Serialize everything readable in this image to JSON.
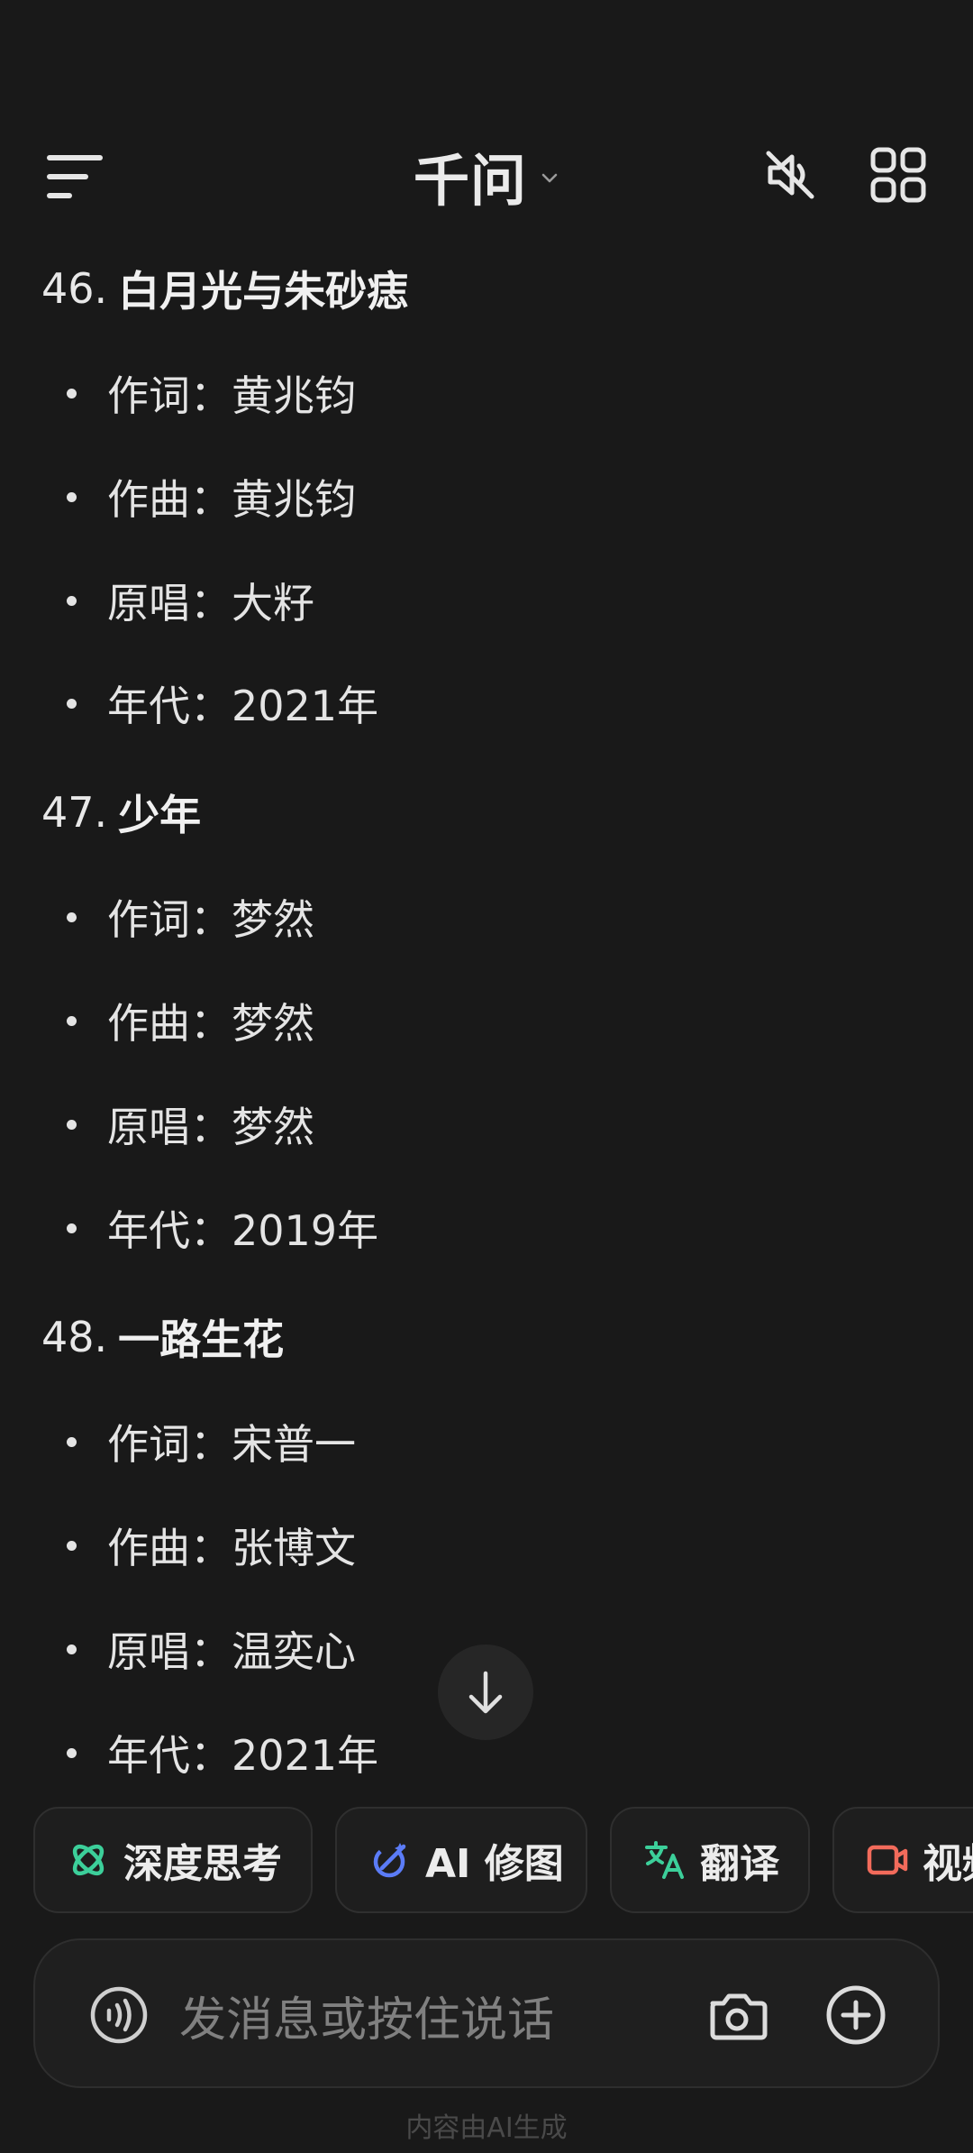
{
  "header": {
    "title": "千问",
    "menu_icon": "menu-lines-icon",
    "mute_icon": "speaker-muted-icon",
    "apps_icon": "grid-apps-icon"
  },
  "songs": [
    {
      "number": "46.",
      "title": "白月光与朱砂痣",
      "lines": [
        "作词：黄兆钧",
        "作曲：黄兆钧",
        "原唱：大籽",
        "年代：2021年"
      ]
    },
    {
      "number": "47.",
      "title": "少年",
      "lines": [
        "作词：梦然",
        "作曲：梦然",
        "原唱：梦然",
        "年代：2019年"
      ]
    },
    {
      "number": "48.",
      "title": "一路生花",
      "lines": [
        "作词：宋普一",
        "作曲：张博文",
        "原唱：温奕心",
        "年代：2021年"
      ]
    }
  ],
  "chips": [
    {
      "label": "深度思考",
      "icon": "deep-think-icon",
      "color": "#3ccf9a"
    },
    {
      "label": "AI 修图",
      "icon": "ai-edit-image-icon",
      "color": "#5b7cf7"
    },
    {
      "label": "翻译",
      "icon": "translate-icon",
      "color": "#3ccf9a"
    },
    {
      "label": "视频",
      "icon": "video-icon",
      "color": "#f26b5b"
    }
  ],
  "input": {
    "placeholder": "发消息或按住说话"
  },
  "footer": {
    "note": "内容由AI生成"
  }
}
